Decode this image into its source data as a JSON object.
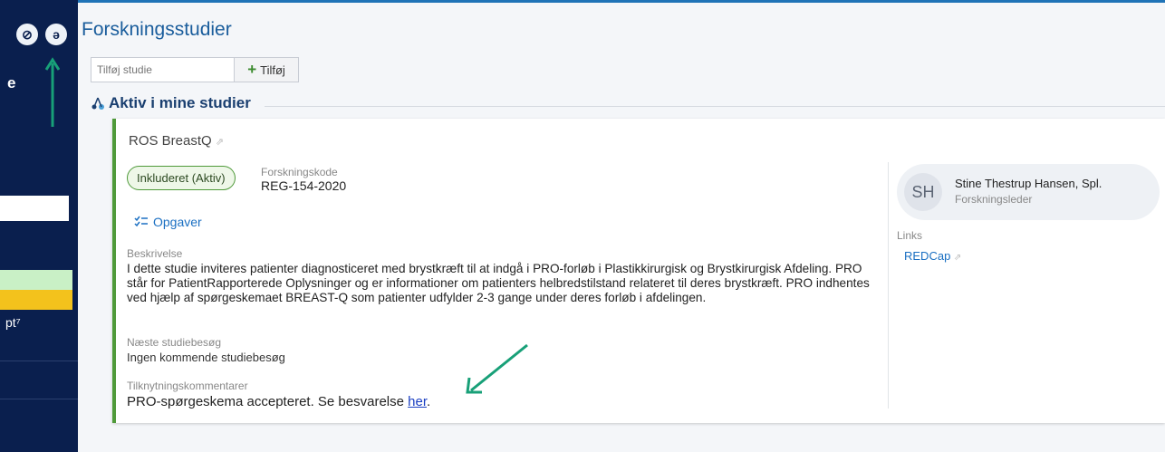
{
  "rail": {
    "text1": "e",
    "text2": "pt⁷"
  },
  "header": {
    "title": "Forskningsstudier"
  },
  "add_study": {
    "placeholder": "Tilføj studie",
    "button_label": "Tilføj"
  },
  "section": {
    "title": "Aktiv i mine studier"
  },
  "study": {
    "name": "ROS BreastQ",
    "status": "Inkluderet (Aktiv)",
    "code_label": "Forskningskode",
    "code_value": "REG-154-2020",
    "tasks_label": "Opgaver",
    "description_label": "Beskrivelse",
    "description": "I dette studie inviteres patienter diagnosticeret med brystkræft til at indgå i PRO-forløb i Plastikkirurgisk og Brystkirurgisk Afdeling. PRO står for PatientRapporterede Oplysninger og er informationer om patienters helbredstilstand relateret til deres brystkræft. PRO indhentes ved hjælp af spørgeskemaet BREAST-Q som patienter udfylder 2-3 gange under deres forløb i afdelingen.",
    "next_visit_label": "Næste studiebesøg",
    "next_visit_value": "Ingen kommende studiebesøg",
    "comments_label": "Tilknytningskommentarer",
    "comment_text": "PRO-spørgeskema accepteret. Se besvarelse ",
    "comment_link": "her",
    "comment_suffix": "."
  },
  "person": {
    "initials": "SH",
    "name": "Stine Thestrup Hansen, Spl.",
    "role": "Forskningsleder"
  },
  "links": {
    "label": "Links",
    "items": [
      "REDCap"
    ]
  },
  "colors": {
    "rail": "#0a1f4e",
    "accent_blue": "#1a5d9c",
    "card_border": "#4f9a3a",
    "annotation_arrow": "#18a078",
    "rail_green": "#c9f0c6",
    "rail_yellow": "#f3c21c"
  }
}
